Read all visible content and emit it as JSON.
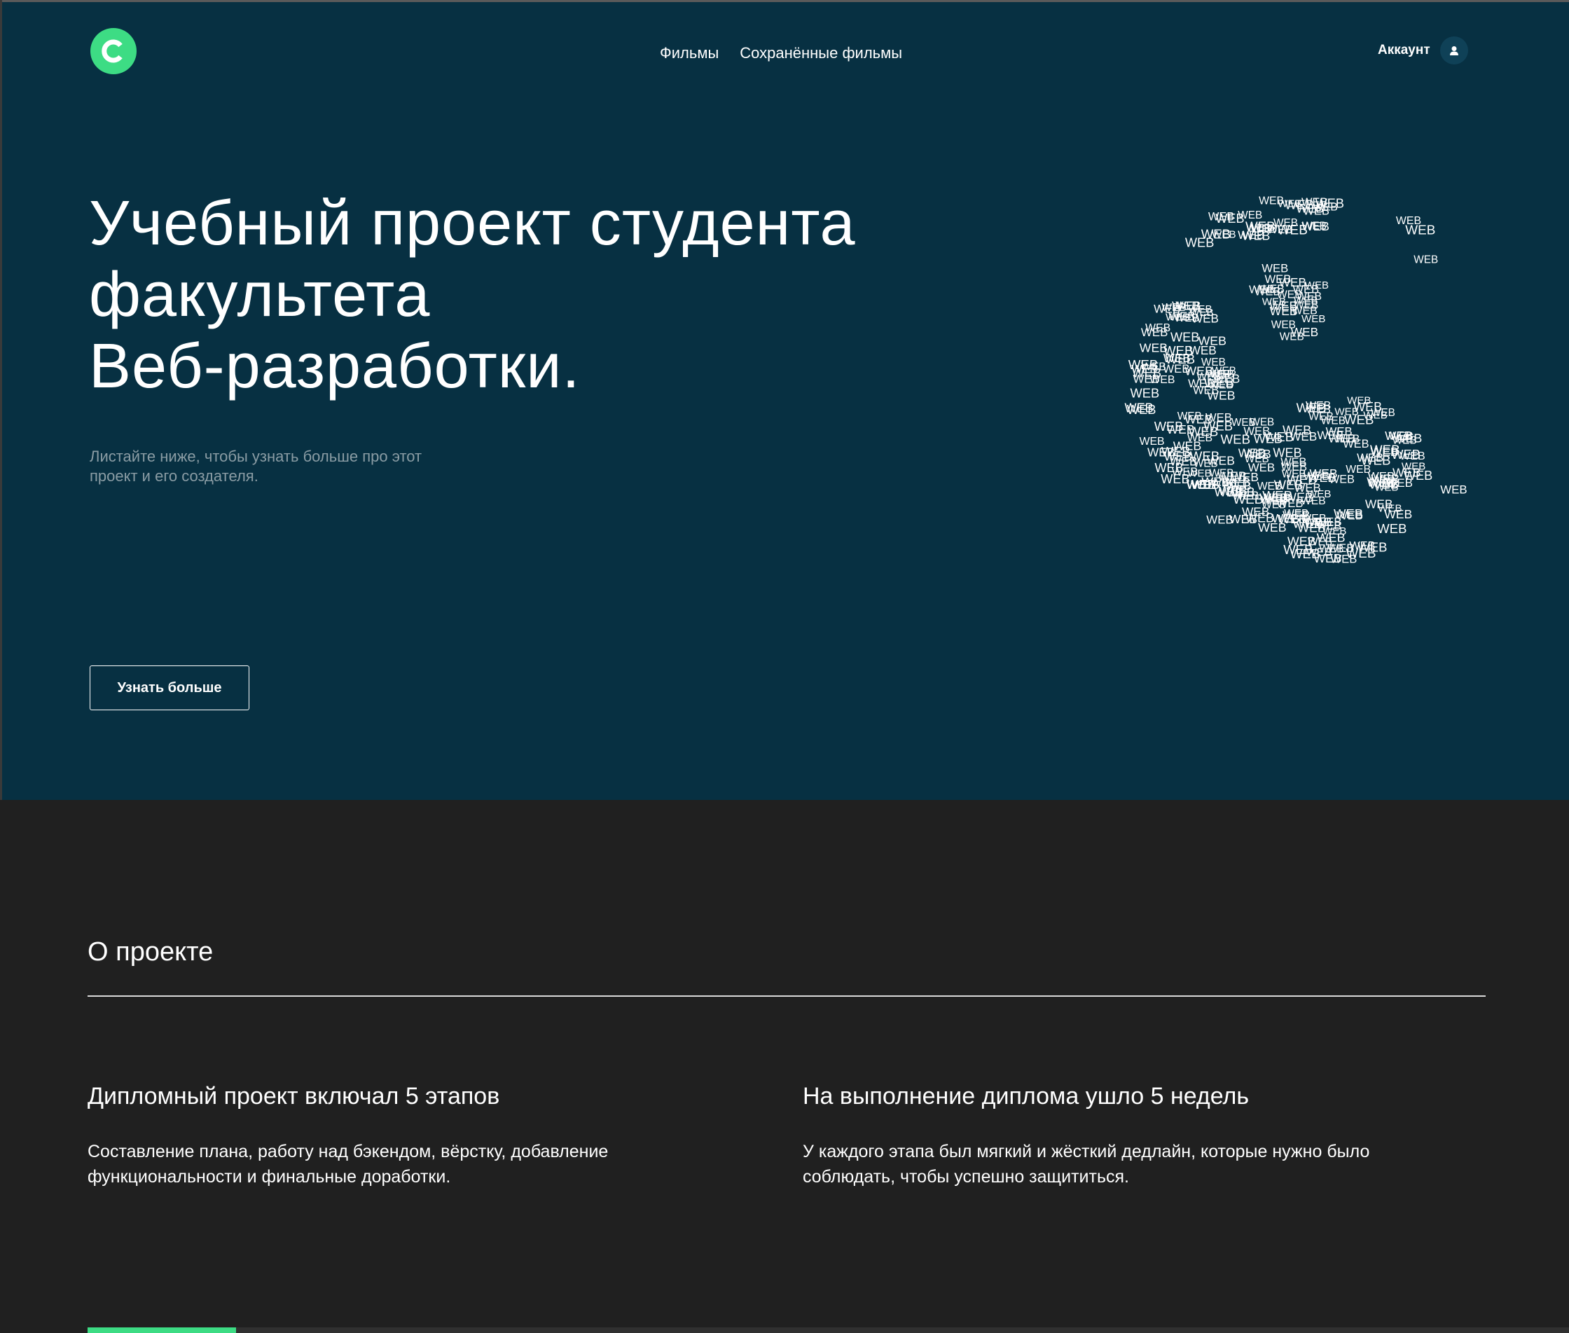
{
  "header": {
    "logo_icon": "c-logo-icon",
    "nav": [
      {
        "label": "Фильмы"
      },
      {
        "label": "Сохранённые фильмы"
      }
    ],
    "account": {
      "label": "Аккаунт",
      "icon": "user-icon"
    }
  },
  "hero": {
    "title_lines": [
      "Учебный проект студента",
      "факультета",
      "Веб-разработки."
    ],
    "subtitle_lines": [
      "Листайте ниже, чтобы узнать больше про этот",
      "проект и его создателя."
    ],
    "button_label": "Узнать больше",
    "globe": {
      "word": "WEB",
      "icon": "web-globe-icon"
    }
  },
  "about": {
    "title": "О проекте",
    "columns": [
      {
        "heading": "Дипломный проект включал 5 этапов",
        "text_lines": [
          "Составление плана, работу над бэкендом, вёрстку, добавление",
          "функциональности и финальные доработки."
        ]
      },
      {
        "heading": "На выполнение диплома ушло 5 недель",
        "text_lines": [
          "У каждого этапа был мягкий и жёсткий дедлайн, которые нужно было",
          "соблюдать, чтобы успешно защититься."
        ]
      }
    ],
    "progress": 0.1
  },
  "colors": {
    "hero_bg": "#073042",
    "page_bg": "#202020",
    "accent": "#3ddc84",
    "subtitle": "#8a9ca4"
  }
}
